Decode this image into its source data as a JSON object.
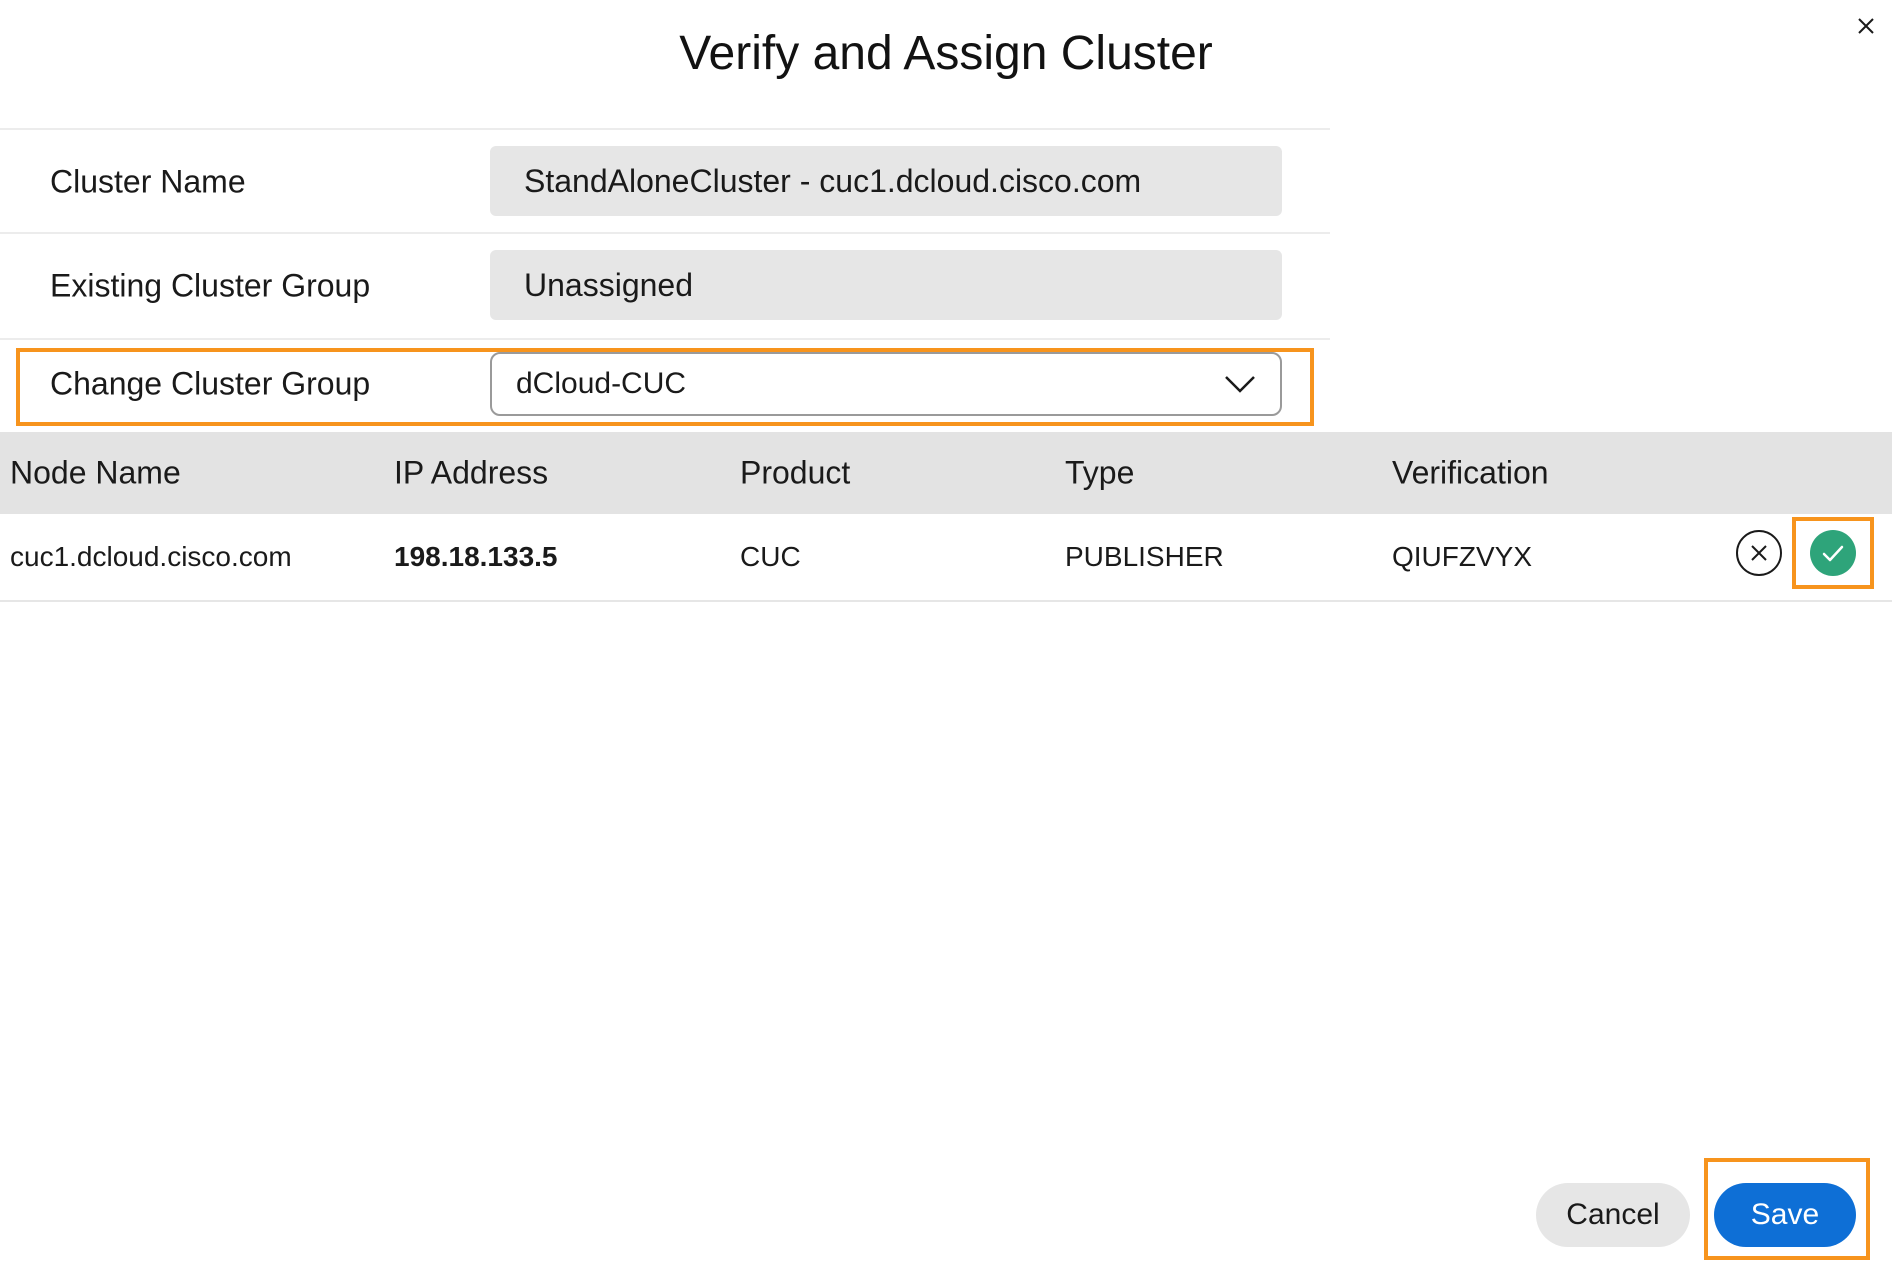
{
  "dialog": {
    "title": "Verify and Assign Cluster"
  },
  "form": {
    "cluster_name_label": "Cluster Name",
    "cluster_name_value": "StandAloneCluster  - cuc1.dcloud.cisco.com",
    "existing_group_label": "Existing Cluster Group",
    "existing_group_value": "Unassigned",
    "change_group_label": "Change Cluster Group",
    "change_group_selected": "dCloud-CUC"
  },
  "table": {
    "columns": [
      "Node Name",
      "IP Address",
      "Product",
      "Type",
      "Verification"
    ],
    "rows": [
      {
        "node_name": "cuc1.dcloud.cisco.com",
        "ip_address": "198.18.133.5",
        "product": "CUC",
        "type": "PUBLISHER",
        "verification": "QIUFZVYX"
      }
    ]
  },
  "footer": {
    "cancel_label": "Cancel",
    "save_label": "Save"
  },
  "icons": {
    "close": "close-icon",
    "dropdown": "chevron-down-icon",
    "reject": "circle-x-icon",
    "accept": "circle-check-icon"
  },
  "colors": {
    "highlight": "#f7941d",
    "primary": "#0e6fd6",
    "success": "#2ea47a",
    "readonly_bg": "#e6e6e6",
    "header_bg": "#e3e3e3"
  }
}
